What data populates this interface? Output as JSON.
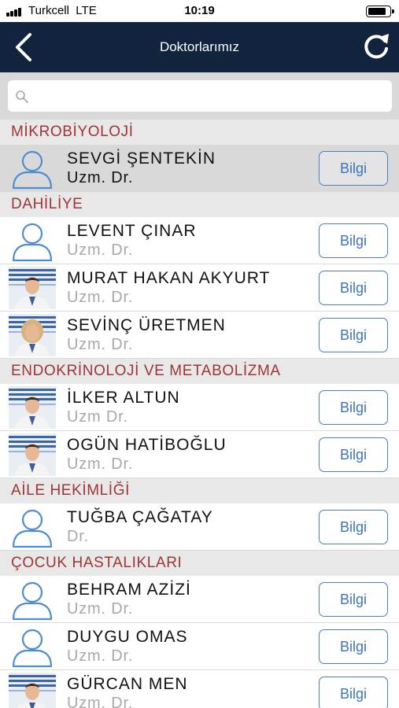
{
  "status_bar": {
    "carrier": "Turkcell",
    "network": "LTE",
    "time": "10:19",
    "battery_level": 0.85
  },
  "nav": {
    "title": "Doktorlarımız",
    "back_icon": "chevron-left-icon",
    "refresh_icon": "refresh-icon"
  },
  "search": {
    "placeholder": "",
    "value": "",
    "icon": "search-icon"
  },
  "colors": {
    "nav_background": "#12233e",
    "section_text": "#a13434",
    "button_blue": "#3d74bb"
  },
  "sections": [
    {
      "title": "MİKROBİYOLOJİ",
      "doctors": [
        {
          "name": "SEVGİ ŞENTEKİN",
          "title": "Uzm. Dr.",
          "button": "Bilgi",
          "photo": "placeholder",
          "selected": true
        }
      ]
    },
    {
      "title": "DAHİLİYE",
      "doctors": [
        {
          "name": "LEVENT ÇINAR",
          "title": "Uzm. Dr.",
          "button": "Bilgi",
          "photo": "placeholder",
          "selected": false
        },
        {
          "name": "MURAT HAKAN AKYURT",
          "title": "Uzm. Dr.",
          "button": "Bilgi",
          "photo": "photo-male",
          "selected": false
        },
        {
          "name": "SEVİNÇ ÜRETMEN",
          "title": "Uzm. Dr.",
          "button": "Bilgi",
          "photo": "photo-female",
          "selected": false
        }
      ]
    },
    {
      "title": "ENDOKRİNOLOJİ VE METABOLİZMA",
      "doctors": [
        {
          "name": "İLKER ALTUN",
          "title": "Uzm Dr.",
          "button": "Bilgi",
          "photo": "photo-male",
          "selected": false
        },
        {
          "name": "OGÜN HATİBOĞLU",
          "title": "Uzm. Dr.",
          "button": "Bilgi",
          "photo": "photo-male",
          "selected": false
        }
      ]
    },
    {
      "title": "AİLE HEKİMLİĞİ",
      "doctors": [
        {
          "name": "TUĞBA ÇAĞATAY",
          "title": "Dr.",
          "button": "Bilgi",
          "photo": "placeholder",
          "selected": false
        }
      ]
    },
    {
      "title": "ÇOCUK HASTALIKLARI",
      "doctors": [
        {
          "name": "BEHRAM AZİZİ",
          "title": "Uzm. Dr.",
          "button": "Bilgi",
          "photo": "placeholder",
          "selected": false
        },
        {
          "name": "DUYGU OMAS",
          "title": "Uzm. Dr.",
          "button": "Bilgi",
          "photo": "placeholder",
          "selected": false
        },
        {
          "name": "GÜRCAN MEN",
          "title": "Uzm. Dr.",
          "button": "Bilgi",
          "photo": "photo-male",
          "selected": false
        }
      ]
    }
  ]
}
